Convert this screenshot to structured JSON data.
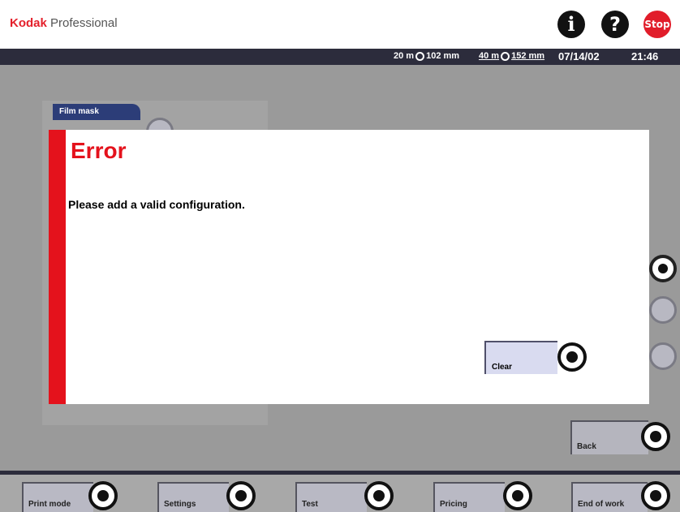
{
  "header": {
    "brand_kodak": "Kodak",
    "brand_professional": "Professional",
    "info_label": "i",
    "help_label": "?",
    "stop_label": "Stop"
  },
  "statusbar": {
    "roll1_length": "20 m",
    "roll1_width": "102 mm",
    "roll2_length": "40 m",
    "roll2_width": "152 mm",
    "date": "07/14/02",
    "time": "21:46"
  },
  "background": {
    "film_mask_tab": "Film mask"
  },
  "dialog": {
    "title": "Error",
    "message": "Please add a valid configuration.",
    "clear_label": "Clear"
  },
  "side": {
    "back_label": "Back"
  },
  "footer": {
    "buttons": [
      {
        "label": "Print mode"
      },
      {
        "label": "Settings"
      },
      {
        "label": "Test"
      },
      {
        "label": "Pricing"
      },
      {
        "label": "End of work"
      }
    ]
  },
  "colors": {
    "accent_red": "#e4121c",
    "status_bar": "#2c2c3c",
    "tab_blue": "#2c3d78"
  }
}
